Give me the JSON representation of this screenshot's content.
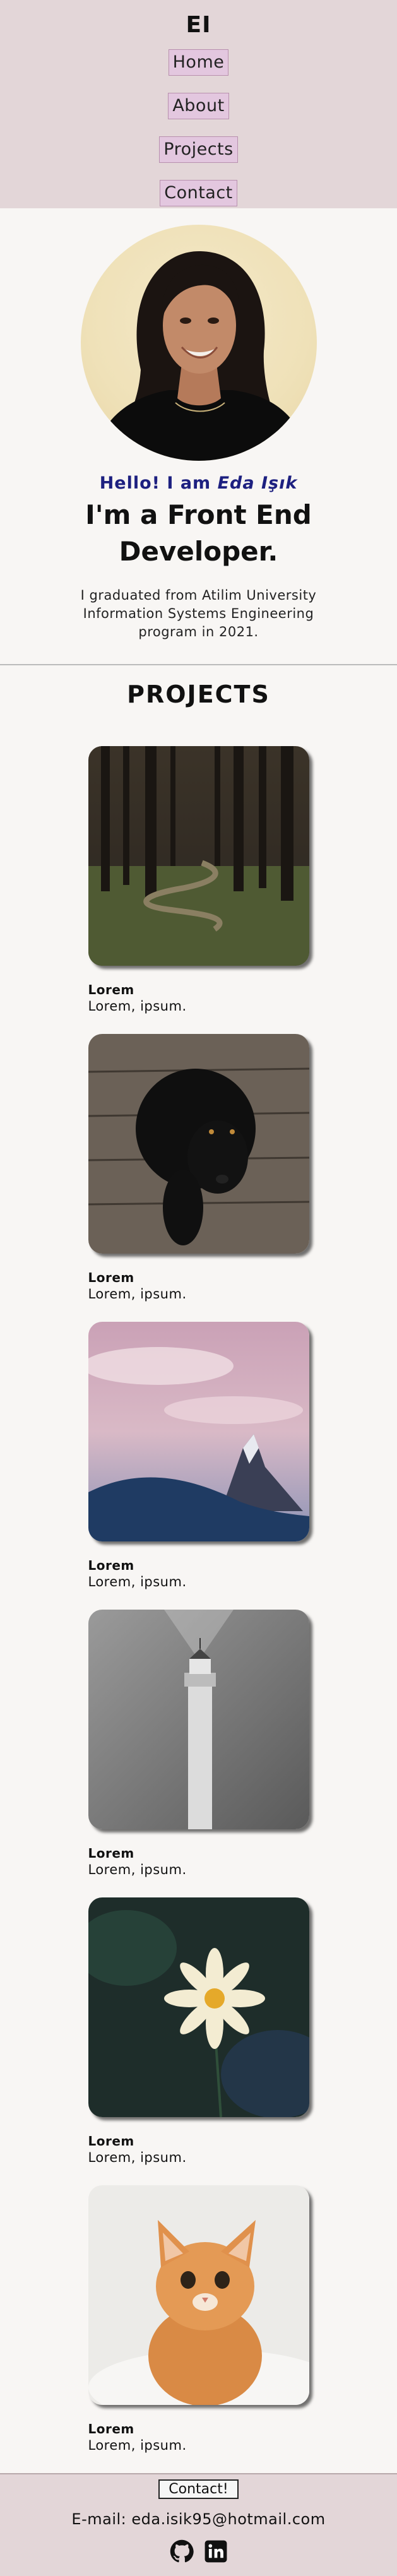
{
  "header": {
    "logo": "EI",
    "nav": [
      {
        "label": "Home"
      },
      {
        "label": "About"
      },
      {
        "label": "Projects"
      },
      {
        "label": "Contact"
      }
    ]
  },
  "hero": {
    "greeting_prefix": "Hello! I am ",
    "greeting_name": "Eda Işık",
    "headline": "I'm a Front End Developer.",
    "intro": "I graduated from Atilim University Information Systems Engineering program in 2021."
  },
  "projects": {
    "title": "PROJECTS",
    "items": [
      {
        "name": "Lorem",
        "desc": "Lorem, ipsum.",
        "image": "forest-path"
      },
      {
        "name": "Lorem",
        "desc": "Lorem, ipsum.",
        "image": "black-dog"
      },
      {
        "name": "Lorem",
        "desc": "Lorem, ipsum.",
        "image": "mountain-sky"
      },
      {
        "name": "Lorem",
        "desc": "Lorem, ipsum.",
        "image": "lighthouse"
      },
      {
        "name": "Lorem",
        "desc": "Lorem, ipsum.",
        "image": "white-flower"
      },
      {
        "name": "Lorem",
        "desc": "Lorem, ipsum.",
        "image": "orange-kitten"
      }
    ]
  },
  "footer": {
    "contact_button": "Contact!",
    "email": "E-mail: eda.isik95@hotmail.com",
    "social": [
      "github-icon",
      "linkedin-icon"
    ]
  },
  "colors": {
    "header_bg": "#e3d6d8",
    "nav_bg": "#e3c7df",
    "greeting": "#1d2080",
    "page_bg": "#f8f6f4"
  }
}
